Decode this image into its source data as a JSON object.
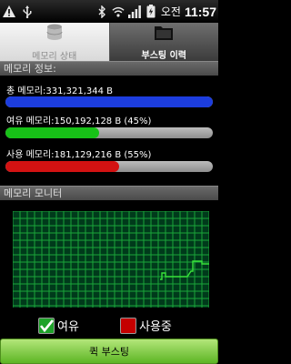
{
  "status_bar": {
    "icons": [
      "warning-icon",
      "usb-icon",
      "bluetooth-icon",
      "wifi-icon",
      "signal-icon",
      "battery-icon"
    ],
    "ampm": "오전",
    "time": "11:57"
  },
  "tabs": [
    {
      "label": "메모리 상태",
      "icon": "database-icon",
      "active": true
    },
    {
      "label": "부스팅 이력",
      "icon": "folder-icon",
      "active": false
    }
  ],
  "memory_info": {
    "title": "메모리 정보:",
    "total": {
      "label": "총 메모리:331,321,344 B",
      "percent": 100,
      "color": "#1c3dde"
    },
    "free": {
      "label": "여유 메모리:150,192,128 B (45%)",
      "percent": 45,
      "color": "#17c117"
    },
    "used": {
      "label": "사용 메모리:181,129,216 B (55%)",
      "percent": 55,
      "color": "#d31212"
    }
  },
  "monitor": {
    "title": "메모리 모니터",
    "grid_color": "#1aa53a",
    "line_color": "#39e13a"
  },
  "legend": {
    "free_label": "여유",
    "used_label": "사용중",
    "free_color": "#1fa22a",
    "used_color": "#c40000"
  },
  "boost_button": {
    "label": "퀵 부스팅"
  }
}
